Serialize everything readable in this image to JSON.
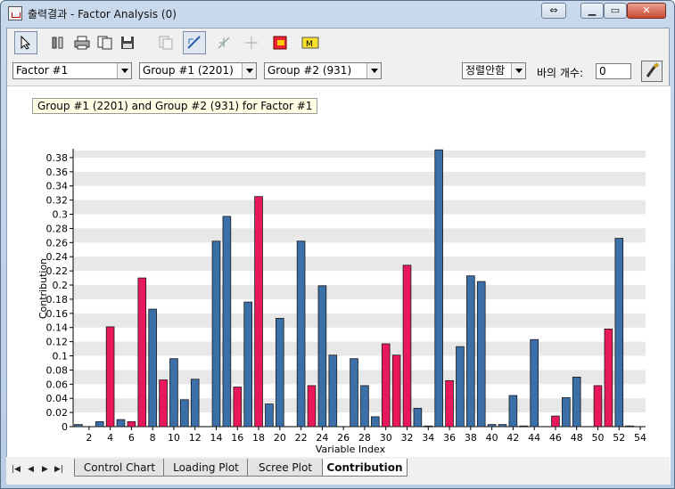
{
  "window": {
    "title": "출력결과 - Factor Analysis (0)"
  },
  "toolbar": {
    "icons": [
      "pointer-icon",
      "tools-icon",
      "print-icon",
      "copy-icon",
      "save-icon",
      "copy-disabled-icon",
      "zoom-select-icon",
      "move-disabled-icon",
      "crosshair-disabled-icon",
      "marker-icon",
      "label-icon"
    ]
  },
  "selectors": {
    "factor": "Factor #1",
    "group1": "Group #1 (2201)",
    "group2": "Group #2 (931)",
    "sort": "정렬안함",
    "bar_count_label": "바의 개수:",
    "bar_count_value": "0"
  },
  "tabs": [
    "Control Chart",
    "Loading Plot",
    "Scree Plot",
    "Contribution"
  ],
  "active_tab": "Contribution",
  "colors": {
    "series_blue": "#3a6fa8",
    "series_red": "#e8185a",
    "band": "#e8e8e8"
  },
  "chart_data": {
    "type": "bar",
    "title": "Group #1 (2201) and Group #2 (931) for Factor #1",
    "xlabel": "Variable Index",
    "ylabel": "Contribution",
    "ylim": [
      0,
      0.39
    ],
    "yticks": [
      0,
      0.02,
      0.04,
      0.06,
      0.08,
      0.1,
      0.12,
      0.14,
      0.16,
      0.18,
      0.2,
      0.22,
      0.24,
      0.26,
      0.28,
      0.3,
      0.32,
      0.34,
      0.36,
      0.38
    ],
    "xticks": [
      2,
      4,
      6,
      8,
      10,
      12,
      14,
      16,
      18,
      20,
      22,
      24,
      26,
      28,
      30,
      32,
      34,
      36,
      38,
      40,
      42,
      44,
      46,
      48,
      50,
      52,
      54
    ],
    "x": [
      1,
      2,
      3,
      4,
      5,
      6,
      7,
      8,
      9,
      10,
      11,
      12,
      13,
      14,
      15,
      16,
      17,
      18,
      19,
      20,
      21,
      22,
      23,
      24,
      25,
      26,
      27,
      28,
      29,
      30,
      31,
      32,
      33,
      34,
      35,
      36,
      37,
      38,
      39,
      40,
      41,
      42,
      43,
      44,
      45,
      46,
      47,
      48,
      49,
      50,
      51,
      52,
      53,
      54
    ],
    "values": [
      0.003,
      0,
      0.007,
      0.141,
      0.01,
      0.007,
      0.21,
      0.166,
      0.066,
      0.096,
      0.038,
      0.067,
      0,
      0.262,
      0.297,
      0.056,
      0.176,
      0.325,
      0.032,
      0.153,
      0,
      0.262,
      0.058,
      0.199,
      0.101,
      0,
      0.096,
      0.058,
      0.014,
      0.117,
      0.101,
      0.228,
      0.026,
      0.001,
      0.391,
      0.065,
      0.113,
      0.213,
      0.205,
      0.003,
      0.003,
      0.044,
      0.001,
      0.123,
      0,
      0.015,
      0.041,
      0.07,
      0,
      0.058,
      0.138,
      0.266,
      0.001,
      0
    ],
    "colors": [
      "blue",
      "blue",
      "blue",
      "red",
      "blue",
      "red",
      "red",
      "blue",
      "red",
      "blue",
      "blue",
      "blue",
      "blue",
      "blue",
      "blue",
      "red",
      "blue",
      "red",
      "blue",
      "blue",
      "blue",
      "blue",
      "red",
      "blue",
      "blue",
      "blue",
      "blue",
      "blue",
      "blue",
      "red",
      "red",
      "red",
      "blue",
      "blue",
      "blue",
      "red",
      "blue",
      "blue",
      "blue",
      "blue",
      "blue",
      "blue",
      "blue",
      "blue",
      "blue",
      "red",
      "blue",
      "blue",
      "blue",
      "red",
      "red",
      "blue",
      "blue",
      "blue"
    ],
    "grid": "horizontal bands",
    "legend": "none"
  }
}
